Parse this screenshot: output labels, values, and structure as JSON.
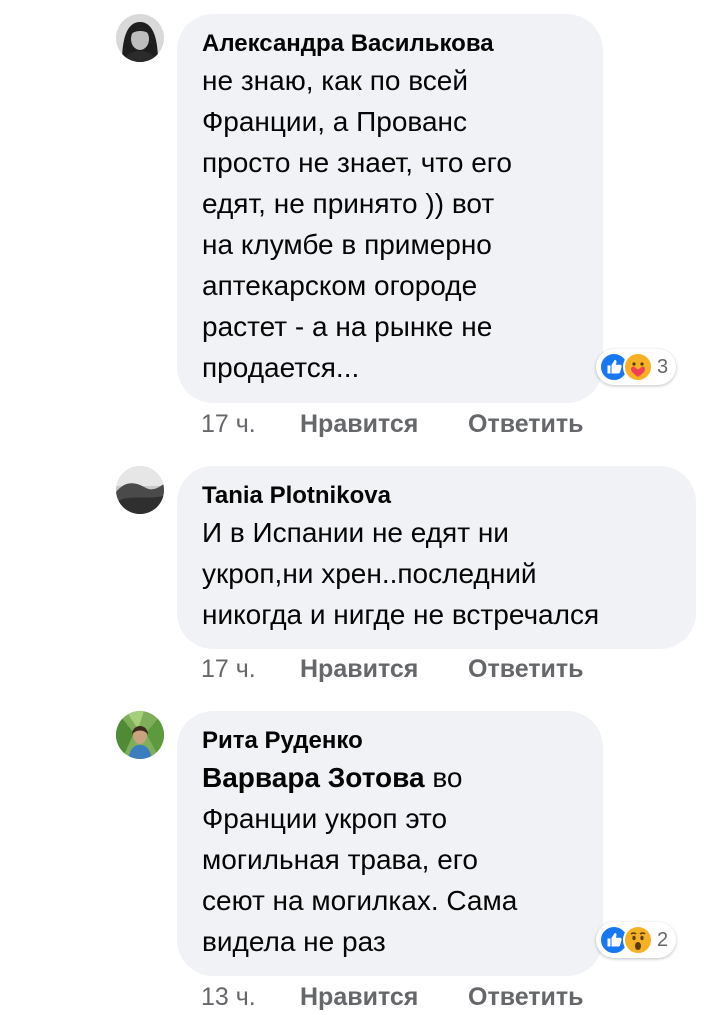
{
  "comments": [
    {
      "author": "Александра Василькова",
      "text": "не знаю, как по всей\nФранции, а Прованс\nпросто не знает, что его\nедят, не принято )) вот\nна клумбе в примерно\nаптекарском огороде\nрастет - а на рынке не\nпродается...",
      "reactions": {
        "icons": [
          "like-icon",
          "care-icon"
        ],
        "count": "3"
      },
      "time": "17 ч.",
      "like_label": "Нравится",
      "reply_label": "Ответить"
    },
    {
      "author": "Tania Plotnikova",
      "text": "И в Испании не едят ни\nукроп,ни хрен..последний\nникогда и нигде не встречался",
      "time": "17 ч.",
      "like_label": "Нравится",
      "reply_label": "Ответить"
    },
    {
      "author": "Рита Руденко",
      "mention": "Варвара Зотова",
      "text": " во\nФранции укроп это\nмогильная трава, его\nсеют на могилках. Сама\nвидела не раз",
      "reactions": {
        "icons": [
          "like-icon",
          "wow-icon"
        ],
        "count": "2"
      },
      "time": "13 ч.",
      "like_label": "Нравится",
      "reply_label": "Ответить"
    }
  ],
  "colors": {
    "bubble": "#f0f2f5",
    "text": "#050505",
    "secondary": "#65676b",
    "like_blue": "#1877f2",
    "reaction_yellow": "#f7b125"
  }
}
